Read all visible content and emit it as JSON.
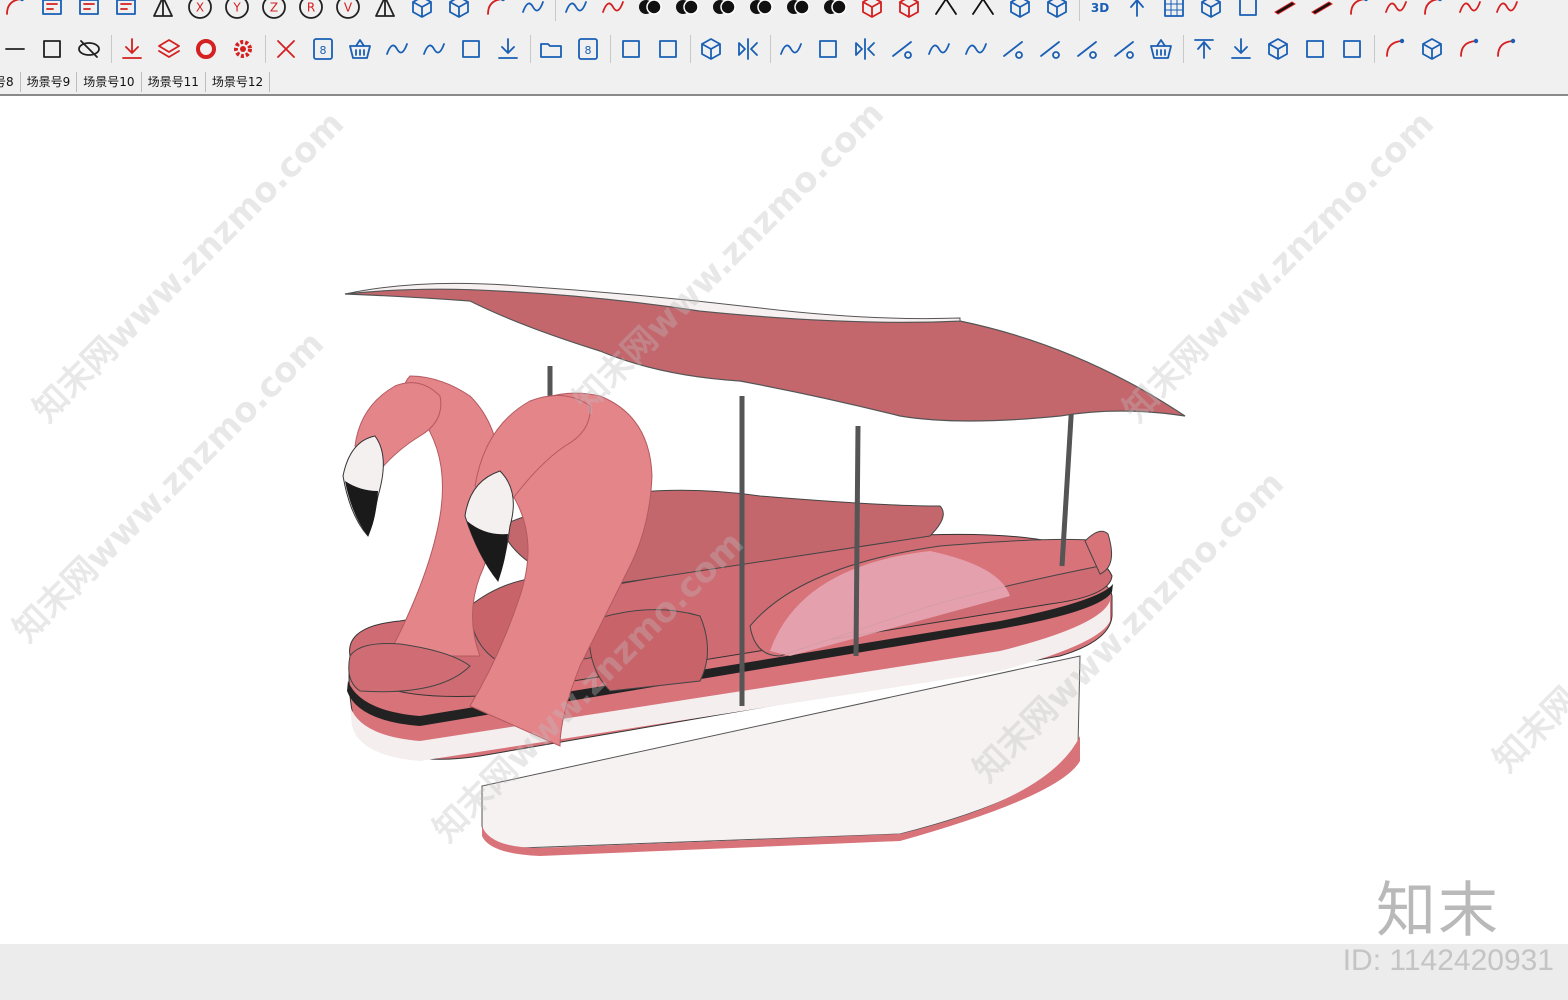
{
  "toolbar_row1": [
    {
      "name": "arc-tool-icon"
    },
    {
      "name": "map-icon"
    },
    {
      "name": "pencil-measure-icon"
    },
    {
      "name": "array-nxn-icon"
    },
    {
      "name": "pyramid-icon"
    },
    {
      "name": "axis-x-icon",
      "glyph": "X"
    },
    {
      "name": "axis-y-icon",
      "glyph": "Y"
    },
    {
      "name": "axis-z-icon",
      "glyph": "Z"
    },
    {
      "name": "rotate-r-icon",
      "glyph": "R"
    },
    {
      "name": "view-v-icon",
      "glyph": "V"
    },
    {
      "name": "diagonal-line-icon"
    },
    {
      "name": "box-icon"
    },
    {
      "name": "box-outline-icon"
    },
    {
      "name": "dome-icon"
    },
    {
      "name": "leaf-curve-icon"
    },
    {
      "name": "separator"
    },
    {
      "name": "s-curve-icon"
    },
    {
      "name": "s-curve-red-icon"
    },
    {
      "name": "solid-union-icon"
    },
    {
      "name": "solid-subtract-icon"
    },
    {
      "name": "solid-intersect-icon"
    },
    {
      "name": "solid-outline-icon"
    },
    {
      "name": "solid-trim-icon"
    },
    {
      "name": "solid-split-icon"
    },
    {
      "name": "building-icon"
    },
    {
      "name": "cube-color-icon"
    },
    {
      "name": "roof-icon"
    },
    {
      "name": "roof-peak-icon"
    },
    {
      "name": "extrude-icon"
    },
    {
      "name": "cylinder-icon"
    },
    {
      "name": "separator"
    },
    {
      "name": "3d-text-icon"
    },
    {
      "name": "push-up-icon"
    },
    {
      "name": "grid-icon"
    },
    {
      "name": "column-icon"
    },
    {
      "name": "panel-icon"
    },
    {
      "name": "beam-icon"
    },
    {
      "name": "beam-dark-icon"
    },
    {
      "name": "lamp-icon"
    },
    {
      "name": "path-icon"
    },
    {
      "name": "paint-icon"
    },
    {
      "name": "spline-icon"
    },
    {
      "name": "spline-edit-icon"
    }
  ],
  "toolbar_row2": [
    {
      "name": "line-tool-icon"
    },
    {
      "name": "rectangle-tool-icon"
    },
    {
      "name": "hide-toggle-icon"
    },
    {
      "name": "separator"
    },
    {
      "name": "import-down-icon"
    },
    {
      "name": "layers-icon"
    },
    {
      "name": "rescue-ring-icon"
    },
    {
      "name": "settings-gear-icon"
    },
    {
      "name": "separator"
    },
    {
      "name": "delete-x-icon"
    },
    {
      "name": "save-8-icon"
    },
    {
      "name": "basket-icon"
    },
    {
      "name": "wave-icon"
    },
    {
      "name": "curve-icon"
    },
    {
      "name": "square-icon"
    },
    {
      "name": "download-icon"
    },
    {
      "name": "separator"
    },
    {
      "name": "open-folder-icon"
    },
    {
      "name": "save-disk-icon"
    },
    {
      "name": "separator"
    },
    {
      "name": "frame-import-icon"
    },
    {
      "name": "frame-export-icon"
    },
    {
      "name": "separator"
    },
    {
      "name": "component-icon"
    },
    {
      "name": "mirror-icon"
    },
    {
      "name": "separator"
    },
    {
      "name": "line-segment-icon"
    },
    {
      "name": "square-select-icon"
    },
    {
      "name": "flip-icon"
    },
    {
      "name": "flower-icon"
    },
    {
      "name": "wave-circle-icon"
    },
    {
      "name": "zigzag-icon"
    },
    {
      "name": "line-erase-icon"
    },
    {
      "name": "dots-erase-icon"
    },
    {
      "name": "cross-cut-icon"
    },
    {
      "name": "rhombus-icon"
    },
    {
      "name": "basket-alt-icon"
    },
    {
      "name": "separator"
    },
    {
      "name": "move-up-icon"
    },
    {
      "name": "move-down-icon"
    },
    {
      "name": "cube-wire-icon"
    },
    {
      "name": "dotted-box-icon"
    },
    {
      "name": "plane-icon"
    },
    {
      "name": "separator"
    },
    {
      "name": "arc-plus-icon"
    },
    {
      "name": "hatch-box-icon"
    },
    {
      "name": "paint-bucket-icon"
    },
    {
      "name": "eyedropper-icon"
    }
  ],
  "scene_tabs": [
    {
      "label": "号8"
    },
    {
      "label": "场景号9"
    },
    {
      "label": "场景号10"
    },
    {
      "label": "场景号11"
    },
    {
      "label": "场景号12"
    }
  ],
  "watermark": {
    "text": "知末网www.znzmo.com",
    "brand_logo": "知末",
    "id_text": "ID: 1142420931"
  },
  "colors": {
    "icon_blue": "#1a5fb4",
    "icon_red": "#d42020",
    "hull_pink": "#d8737a",
    "canopy_pink": "#c4676d",
    "flamingo_pink": "#e4858a"
  }
}
